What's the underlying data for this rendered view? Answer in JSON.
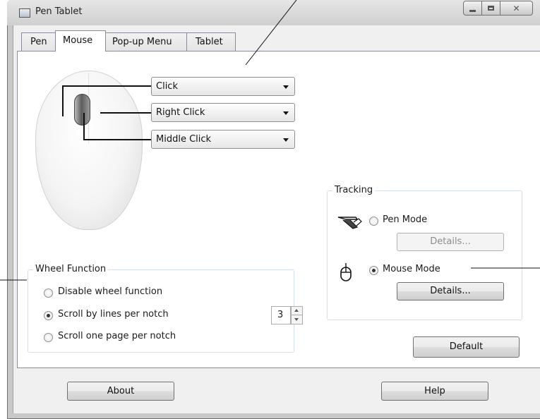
{
  "window": {
    "title": "Pen Tablet"
  },
  "tabs": [
    {
      "label": "Pen"
    },
    {
      "label": "Mouse"
    },
    {
      "label": "Pop-up Menu"
    },
    {
      "label": "Tablet"
    }
  ],
  "active_tab": "Mouse",
  "mouse_buttons": {
    "left": {
      "value": "Click"
    },
    "right": {
      "value": "Right Click"
    },
    "middle": {
      "value": "Middle Click"
    }
  },
  "wheel_function": {
    "title": "Wheel Function",
    "options": [
      {
        "label": "Disable wheel function",
        "checked": false
      },
      {
        "label": "Scroll by lines per notch",
        "checked": true
      },
      {
        "label": "Scroll one page per notch",
        "checked": false
      }
    ],
    "lines_per_notch": "3"
  },
  "tracking": {
    "title": "Tracking",
    "pen_mode": {
      "label": "Pen Mode",
      "checked": false,
      "details_label": "Details...",
      "details_enabled": false
    },
    "mouse_mode": {
      "label": "Mouse Mode",
      "checked": true,
      "details_label": "Details...",
      "details_enabled": true
    }
  },
  "buttons": {
    "default_label": "Default",
    "about_label": "About",
    "help_label": "Help"
  },
  "icons": {
    "title_icon": "window-icon",
    "pen_mode_icon": "pen-icon",
    "mouse_mode_icon": "mouse-icon",
    "minimize": "minimize-icon",
    "maximize": "maximize-icon",
    "close": "close-icon"
  }
}
